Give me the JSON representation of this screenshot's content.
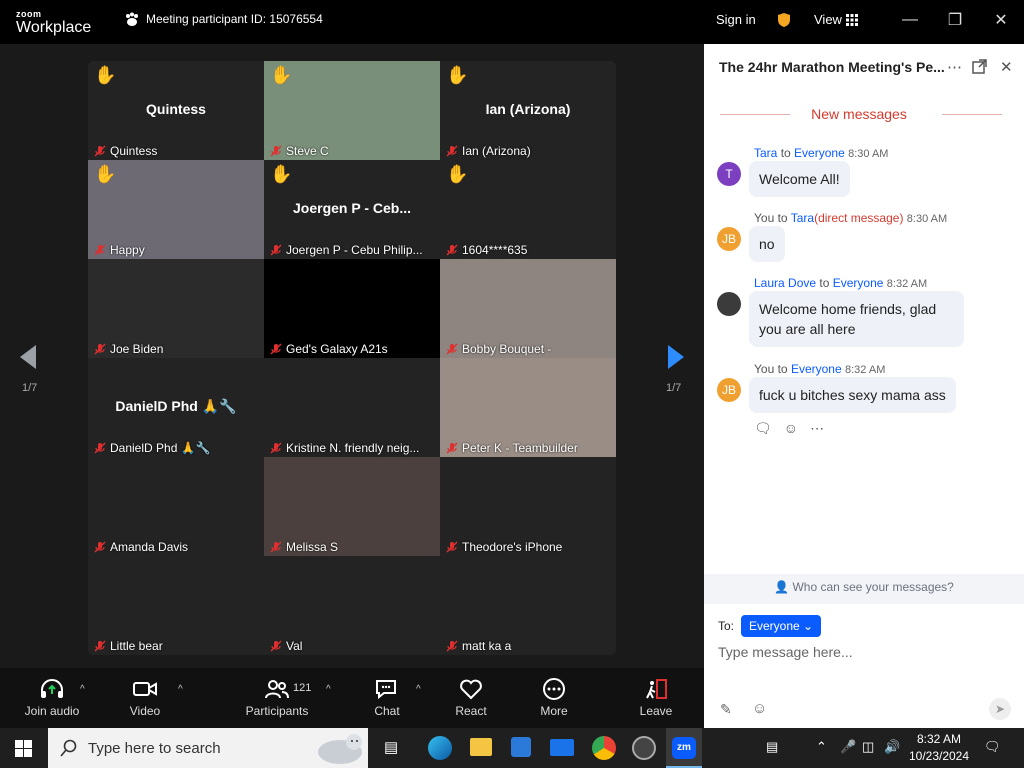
{
  "titlebar": {
    "logo_top": "zoom",
    "logo_bottom": "Workplace",
    "meeting_id": "Meeting participant ID: 15076554",
    "sign_in": "Sign in",
    "view": "View"
  },
  "pager": {
    "left": "1/7",
    "right": "1/7"
  },
  "tiles": [
    {
      "name": "Quintess",
      "center": "Quintess",
      "hand": true,
      "bg": "#232323"
    },
    {
      "name": "Steve C",
      "center": "",
      "hand": true,
      "bg": "#7a8f7a"
    },
    {
      "name": "Ian (Arizona)",
      "center": "Ian (Arizona)",
      "hand": true,
      "bg": "#232323"
    },
    {
      "name": "Happy",
      "center": "",
      "hand": true,
      "bg": "#6d6a74"
    },
    {
      "name": "Joergen P - Cebu Philip...",
      "center": "Joergen P - Ceb...",
      "hand": true,
      "bg": "#232323"
    },
    {
      "name": "1604****635",
      "center": "",
      "hand": true,
      "bg": "#232323"
    },
    {
      "name": "Joe Biden",
      "center": "",
      "hand": false,
      "bg": "#2b2b2b"
    },
    {
      "name": "Ged's Galaxy A21s",
      "center": "",
      "hand": false,
      "bg": "#000000"
    },
    {
      "name": "Bobby Bouquet -",
      "center": "",
      "hand": false,
      "bg": "#8e8580"
    },
    {
      "name": "DanielD Phd 🙏🔧",
      "center": "DanielD  Phd 🙏🔧",
      "hand": false,
      "bg": "#232323"
    },
    {
      "name": "Kristine N. friendly neig...",
      "center": "",
      "hand": false,
      "bg": "#232323"
    },
    {
      "name": "Peter K - Teambuilder",
      "center": "",
      "hand": false,
      "bg": "#9a8d86"
    },
    {
      "name": "Amanda Davis",
      "center": "",
      "hand": false,
      "bg": "#232323"
    },
    {
      "name": "Melissa S",
      "center": "",
      "hand": false,
      "bg": "#4b403d"
    },
    {
      "name": "Theodore's iPhone",
      "center": "",
      "hand": false,
      "bg": "#232323"
    },
    {
      "name": "Little bear",
      "center": "",
      "hand": false,
      "bg": "#232323"
    },
    {
      "name": "Val",
      "center": "",
      "hand": false,
      "bg": "#232323"
    },
    {
      "name": "matt ka a",
      "center": "",
      "hand": false,
      "bg": "#232323"
    }
  ],
  "toolbar": {
    "join_audio": "Join audio",
    "video": "Video",
    "participants": "Participants",
    "participants_count": "121",
    "chat": "Chat",
    "react": "React",
    "more": "More",
    "leave": "Leave"
  },
  "chat": {
    "title": "The 24hr Marathon Meeting's Pe...",
    "new_messages": "New messages",
    "messages": [
      {
        "from": "Tara",
        "to_word": "to",
        "to": "Everyone",
        "dm": "",
        "time": "8:30 AM",
        "avatar": "T",
        "avatar_color": "#7b3fbf",
        "text": "Welcome All!"
      },
      {
        "from": "You",
        "to_word": "to",
        "to": "Tara",
        "dm": "(direct message)",
        "time": "8:30 AM",
        "avatar": "JB",
        "avatar_color": "#f0a030",
        "text": "no"
      },
      {
        "from": "Laura Dove",
        "to_word": "to",
        "to": "Everyone",
        "dm": "",
        "time": "8:32 AM",
        "avatar": "",
        "avatar_color": "#3b3b3b",
        "text": "Welcome home friends, glad you are all here"
      },
      {
        "from": "You",
        "to_word": "to",
        "to": "Everyone",
        "dm": "",
        "time": "8:32 AM",
        "avatar": "JB",
        "avatar_color": "#f0a030",
        "text": "fuck u bitches sexy mama ass"
      }
    ],
    "who_can_see": "Who can see your messages?",
    "to_label": "To:",
    "recipient": "Everyone",
    "input_placeholder": "Type message here..."
  },
  "taskbar": {
    "search_placeholder": "Type here to search",
    "time": "8:32 AM",
    "date": "10/23/2024"
  }
}
